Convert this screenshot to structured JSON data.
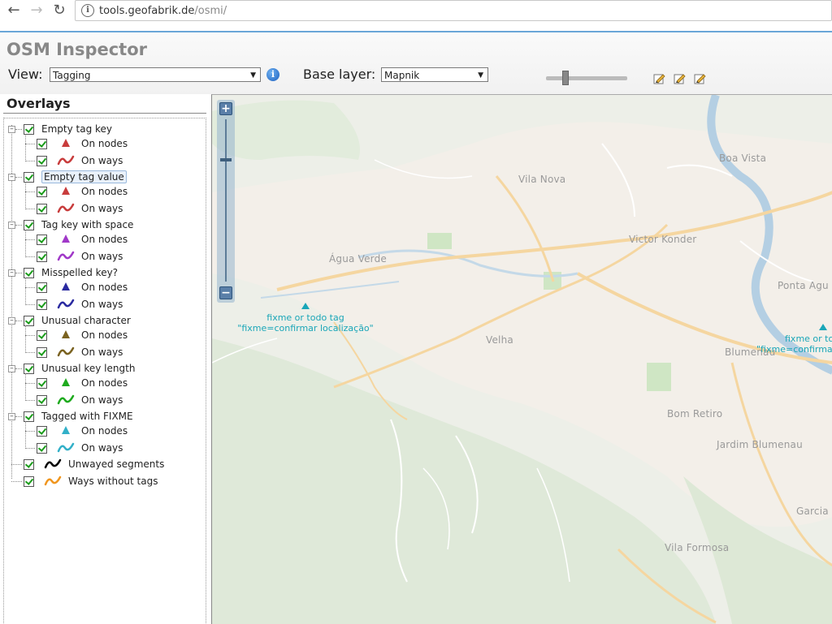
{
  "browser": {
    "url_host": "tools.geofabrik.de",
    "url_path": "/osmi/"
  },
  "header": {
    "title": "OSM Inspector",
    "view_label": "View:",
    "view_value": "Tagging",
    "base_label": "Base layer:",
    "base_value": "Mapnik"
  },
  "overlays": {
    "title": "Overlays",
    "groups": [
      {
        "label": "Empty tag key",
        "color": "#c83c3c",
        "nodes": "On nodes",
        "ways": "On ways"
      },
      {
        "label": "Empty tag value",
        "color": "#c83c3c",
        "nodes": "On nodes",
        "ways": "On ways"
      },
      {
        "label": "Tag key with space",
        "color": "#a038c8",
        "nodes": "On nodes",
        "ways": "On ways"
      },
      {
        "label": "Misspelled key?",
        "color": "#2a2aa0",
        "nodes": "On nodes",
        "ways": "On ways"
      },
      {
        "label": "Unusual character",
        "color": "#7a6220",
        "nodes": "On nodes",
        "ways": "On ways"
      },
      {
        "label": "Unusual key length",
        "color": "#1eaa1e",
        "nodes": "On nodes",
        "ways": "On ways"
      },
      {
        "label": "Tagged with FIXME",
        "color": "#32b0c8",
        "nodes": "On nodes",
        "ways": "On ways"
      }
    ],
    "singles": [
      {
        "label": "Unwayed segments",
        "color": "#000000"
      },
      {
        "label": "Ways without tags",
        "color": "#f0961e"
      }
    ]
  },
  "map": {
    "labels": [
      {
        "text": "Vila Nova"
      },
      {
        "text": "Victor Konder"
      },
      {
        "text": "Água Verde"
      },
      {
        "text": "Boa Vista"
      },
      {
        "text": "Ponta Agu"
      },
      {
        "text": "Velha"
      },
      {
        "text": "Blumenau"
      },
      {
        "text": "Bom Retiro"
      },
      {
        "text": "Jardim Blumenau"
      },
      {
        "text": "Garcia"
      },
      {
        "text": "Vila Formosa"
      }
    ],
    "fixme_left": {
      "line1": "fixme or todo tag",
      "line2": "\"fixme=confirmar localização\""
    },
    "fixme_right": {
      "line1": "fixme or to",
      "line2": "\"fixme=confirma"
    }
  }
}
